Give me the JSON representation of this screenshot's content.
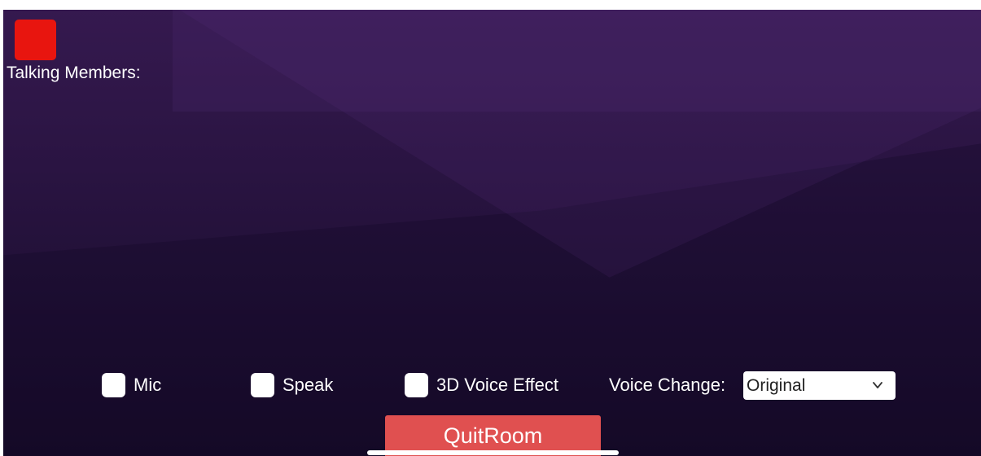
{
  "room": {
    "talking_members_label": "Talking Members:",
    "indicator_color": "#e8150f"
  },
  "controls": {
    "mic_label": "Mic",
    "speak_label": "Speak",
    "voice3d_label": "3D Voice Effect",
    "voice_change_label": "Voice Change:",
    "voice_change_value": "Original",
    "dropdown_icon": "chevron-down-icon"
  },
  "actions": {
    "quit_label": "QuitRoom",
    "quit_color": "#e05050"
  }
}
